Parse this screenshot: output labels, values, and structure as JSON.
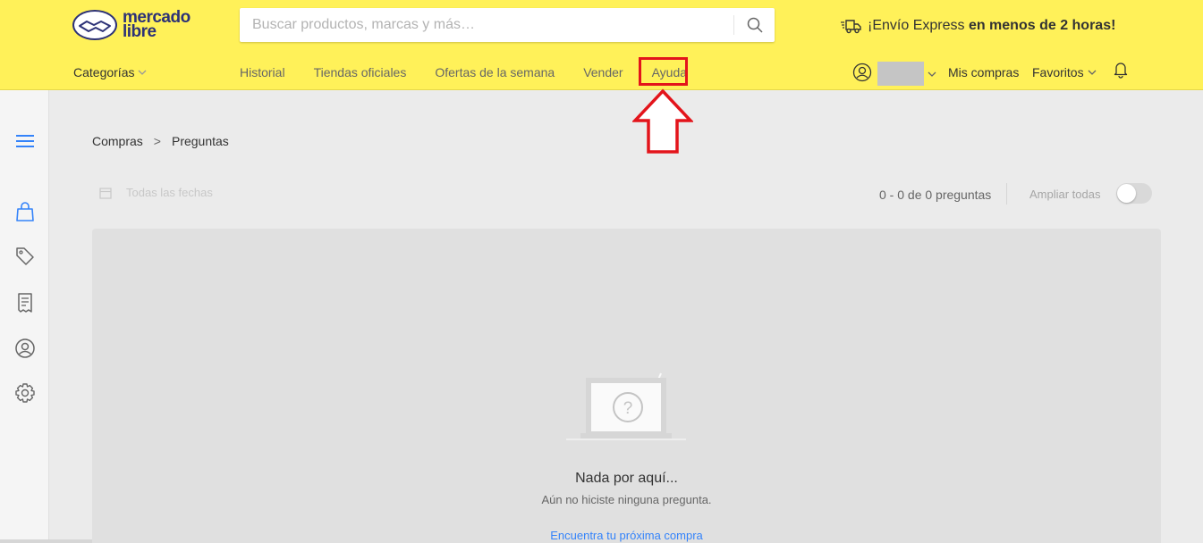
{
  "header": {
    "logo": {
      "line1": "mercado",
      "line2": "libre"
    },
    "search": {
      "placeholder": "Buscar productos, marcas y más…",
      "value": ""
    },
    "promo": {
      "prefix": "¡Envío Express ",
      "strong": "en menos de 2 horas!"
    },
    "categories_label": "Categorías",
    "nav": [
      "Historial",
      "Tiendas oficiales",
      "Ofertas de la semana",
      "Vender",
      "Ayuda"
    ],
    "mis_compras": "Mis compras",
    "favoritos": "Favoritos"
  },
  "sidebar": {
    "items": [
      "menu-icon",
      "shopping-bag-icon",
      "tag-icon",
      "receipt-icon",
      "profile-icon",
      "settings-icon"
    ]
  },
  "breadcrumb": {
    "parent": "Compras",
    "separator": ">",
    "current": "Preguntas"
  },
  "filter": {
    "date_label": "Todas las fechas"
  },
  "summary": {
    "count_text": "0 - 0 de 0 preguntas",
    "expand_label": "Ampliar todas",
    "expand_on": false
  },
  "empty_state": {
    "title": "Nada por aquí...",
    "subtitle": "Aún no hiciste ninguna pregunta.",
    "link": "Encuentra tu próxima compra"
  },
  "colors": {
    "header_bg": "#fff159",
    "brand_blue": "#2d3277",
    "link_blue": "#3483fa",
    "highlight_red": "#e3141b",
    "sidebar_accent": "#3483fa"
  }
}
